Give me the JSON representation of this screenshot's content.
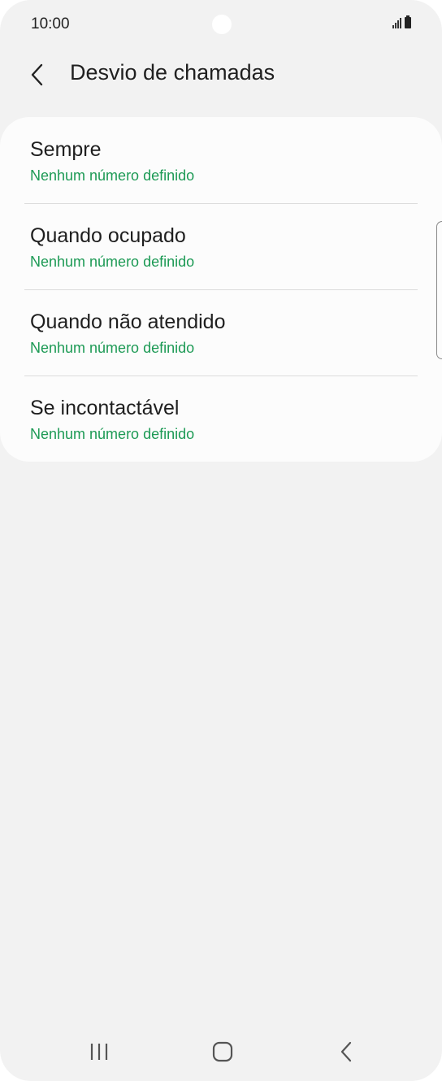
{
  "status_bar": {
    "time": "10:00"
  },
  "app_bar": {
    "title": "Desvio de chamadas",
    "back_icon": "chevron-left-icon"
  },
  "items": [
    {
      "title": "Sempre",
      "subtitle": "Nenhum número definido"
    },
    {
      "title": "Quando ocupado",
      "subtitle": "Nenhum número definido"
    },
    {
      "title": "Quando não atendido",
      "subtitle": "Nenhum número definido"
    },
    {
      "title": "Se incontactável",
      "subtitle": "Nenhum número definido"
    }
  ],
  "nav_bar": {
    "recents_icon": "recents-icon",
    "home_icon": "home-icon",
    "back_icon": "back-icon"
  },
  "colors": {
    "background": "#f2f2f2",
    "card": "#fcfcfc",
    "accent_green": "#1d9a55",
    "text": "#1f1f1f"
  }
}
